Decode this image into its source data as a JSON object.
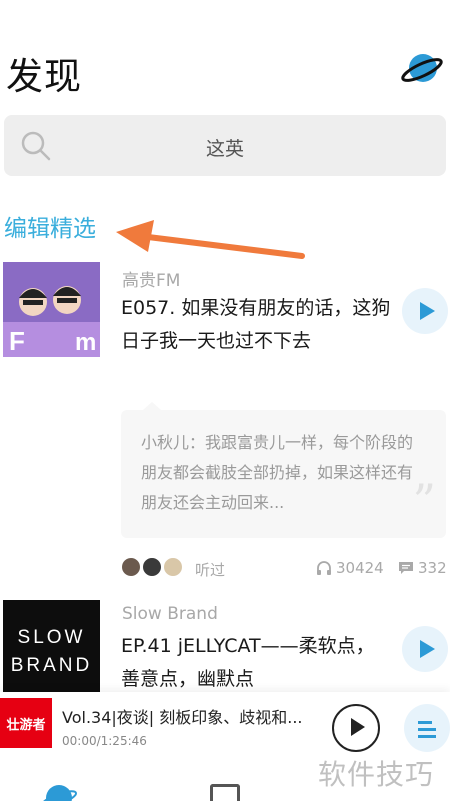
{
  "header": {
    "title": "发现",
    "planet_icon": "planet-icon"
  },
  "search": {
    "placeholder": "这英"
  },
  "section": {
    "title": "编辑精选"
  },
  "podcasts": [
    {
      "channel": "高贵FM",
      "title": "E057. 如果没有朋友的话，这狗日子我一天也过不下去",
      "comment": "小秋儿：我跟富贵儿一样，每个阶段的朋友都会截肢全部扔掉，如果这样还有朋友还会主动回来...",
      "heard_label": "听过",
      "listens": "30424",
      "comments": "332"
    },
    {
      "channel": "Slow Brand",
      "title": "EP.41 jELLYCAT——柔软点，善意点，幽默点",
      "cover_text_1": "SLOW",
      "cover_text_2": "BRAND"
    }
  ],
  "player": {
    "thumb_text": "壮游者",
    "title": "Vol.34|夜谈| 刻板印象、歧视和...",
    "time": "00:00/1:25:46"
  },
  "watermark": "软件技巧",
  "colors": {
    "accent": "#3aaedc",
    "play_bg": "#e7f3fb",
    "arrow": "#f07a3c"
  }
}
